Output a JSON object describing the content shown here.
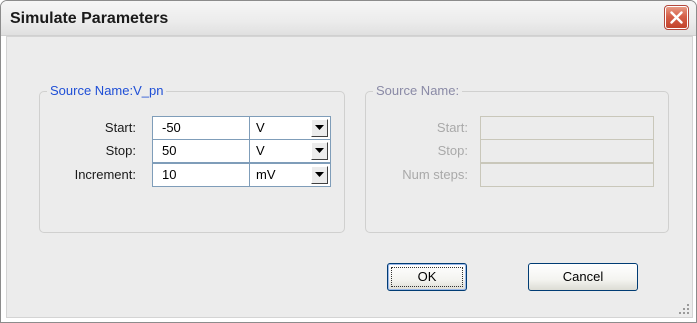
{
  "window": {
    "title": "Simulate Parameters"
  },
  "icons": {
    "close": "close-icon",
    "dropdown": "chevron-down-icon",
    "resize": "resize-grip-icon"
  },
  "colors": {
    "legend_active": "#1f4fd6",
    "close_button": "#d66049",
    "dialog_bg": "#ececec"
  },
  "source_left": {
    "legend": "Source Name:V_pn",
    "start_label": "Start:",
    "start_value": "-50",
    "start_unit": "V",
    "stop_label": "Stop:",
    "stop_value": "50",
    "stop_unit": "V",
    "increment_label": "Increment:",
    "increment_value": "10",
    "increment_unit": "mV"
  },
  "source_right": {
    "legend": "Source Name:",
    "start_label": "Start:",
    "start_value": "",
    "stop_label": "Stop:",
    "stop_value": "",
    "num_steps_label": "Num steps:",
    "num_steps_value": ""
  },
  "buttons": {
    "ok": "OK",
    "cancel": "Cancel"
  }
}
